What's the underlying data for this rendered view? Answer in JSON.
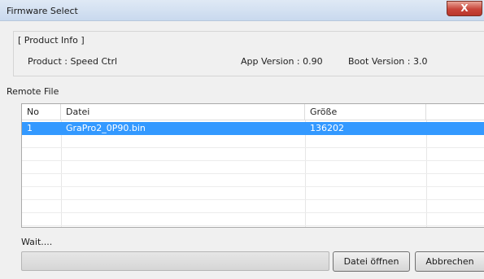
{
  "window": {
    "title": "Firmware Select",
    "close_label": "X"
  },
  "product_info": {
    "legend": "[ Product Info ]",
    "product": "Product : Speed Ctrl",
    "app_version": "App Version : 0.90",
    "boot_version": "Boot Version : 3.0"
  },
  "remote_file": {
    "label": "Remote File",
    "columns": [
      "No",
      "Datei",
      "Größe"
    ],
    "rows": [
      {
        "no": "1",
        "datei": "GraPro2_0P90.bin",
        "groesse": "136202",
        "selected": true
      }
    ]
  },
  "status": {
    "text": "Wait....",
    "progress": 0
  },
  "buttons": {
    "open": "Datei öffnen",
    "cancel": "Abbrechen"
  },
  "colors": {
    "selection": "#3399ff",
    "close_button": "#c8453a"
  }
}
